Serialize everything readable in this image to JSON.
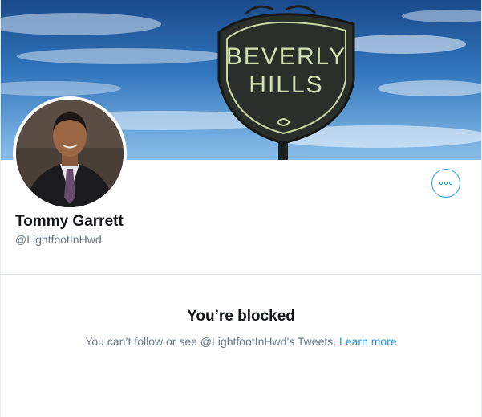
{
  "profile": {
    "name": "Tommy Garrett",
    "handle": "@LightfootInHwd",
    "banner_sign_line1": "BEVERLY",
    "banner_sign_line2": "HILLS"
  },
  "blocked": {
    "title": "You’re blocked",
    "message": "You can’t follow or see @LightfootInHwd’s Tweets.",
    "learn_more": "Learn more"
  },
  "colors": {
    "accent": "#1da1f2",
    "link": "#1b95e0",
    "text_primary": "#14171a",
    "text_secondary": "#657786",
    "divider": "#e6ecf0"
  },
  "icons": {
    "more_options": "more-options-icon"
  }
}
